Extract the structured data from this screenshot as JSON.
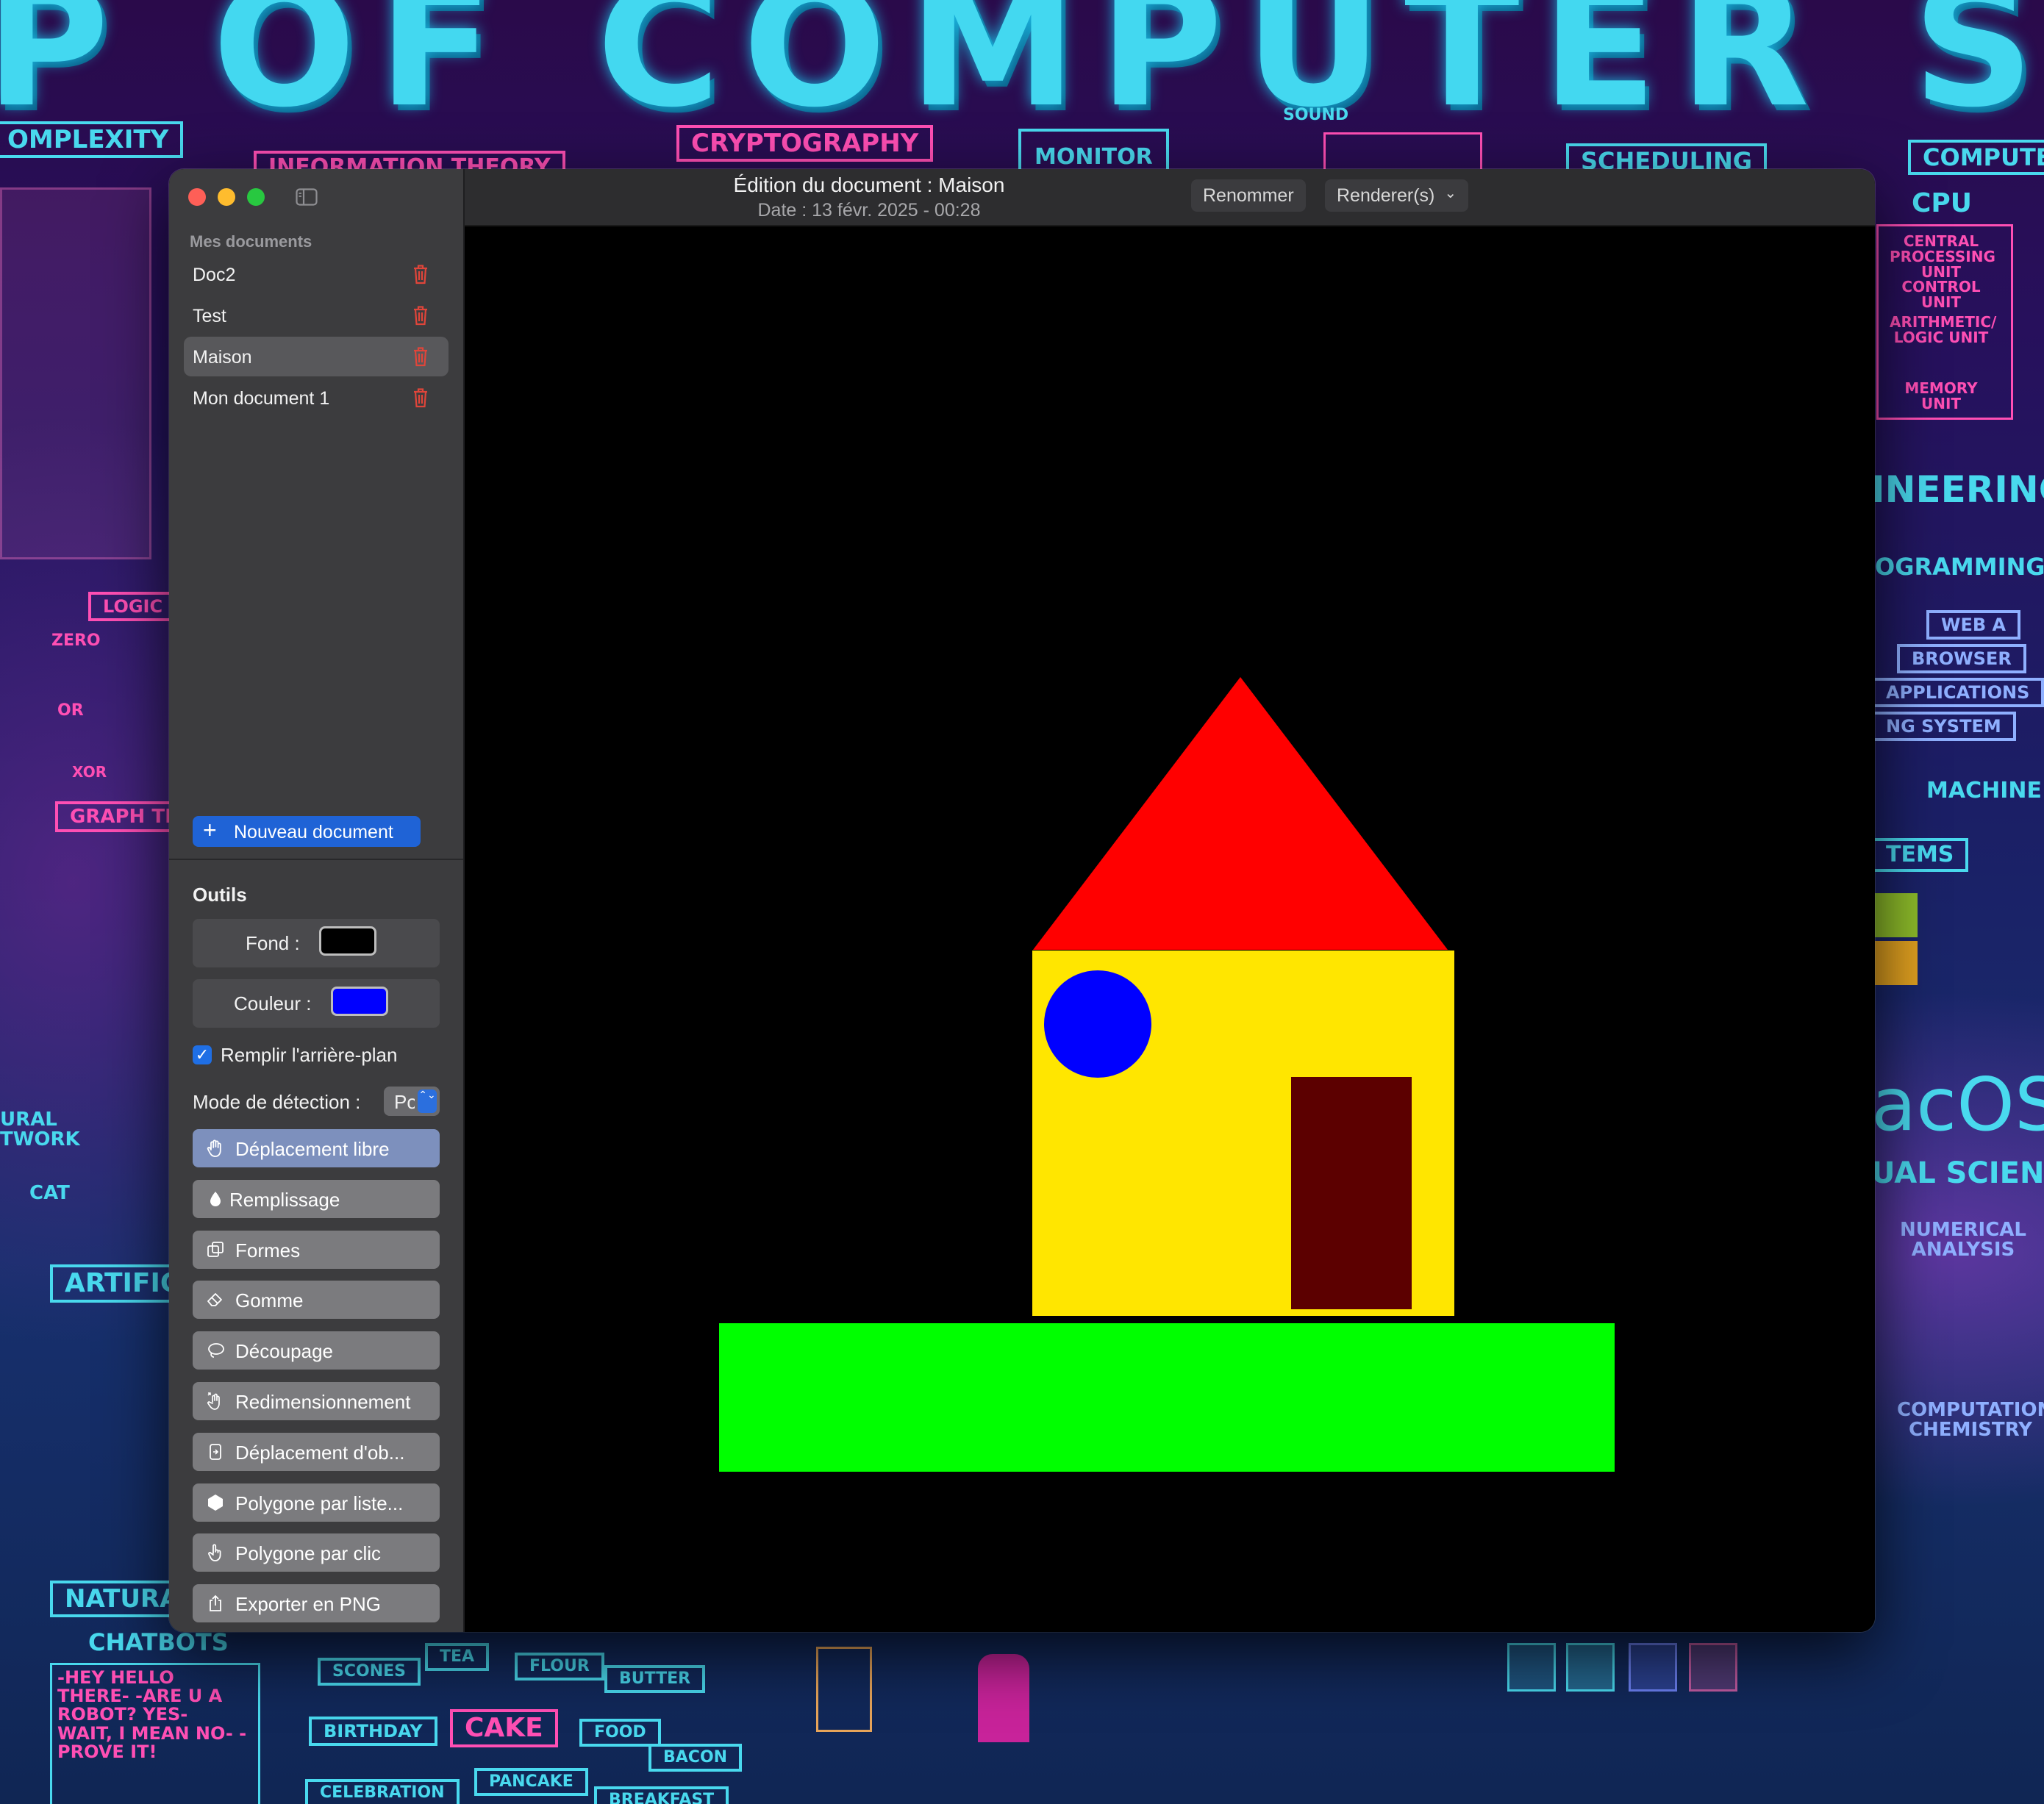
{
  "wallpaper": {
    "title": "P OF COMPUTER SCIE",
    "labels": {
      "complexity": "OMPLEXITY",
      "information_theory": "INFORMATION THEORY",
      "cryptography": "CRYPTOGRAPHY",
      "monitor": "MONITOR",
      "sound": "SOUND",
      "scheduling": "SCHEDULING",
      "compute": "COMPUTE",
      "cpu": "CPU",
      "central_processing_unit": "CENTRAL PROCESSING UNIT",
      "control_unit": "CONTROL UNIT",
      "alu": "ARITHMETIC/ LOGIC UNIT",
      "memory_unit": "MEMORY UNIT",
      "engineering": "INEERING",
      "programming": "OGRAMMING L",
      "web": "WEB A",
      "browser": "BROWSER",
      "applications": "APPLICATIONS",
      "os_system": "NG SYSTEM",
      "machine": "MACHINE C",
      "tems": "TEMS",
      "macos": "acOS",
      "ual_science": "UAL SCIENCE",
      "numerical_analysis": "NUMERICAL ANALYSIS",
      "computational_chemistry": "COMPUTATIONAL CHEMISTRY",
      "logic": "LOGIC",
      "zero": "ZERO",
      "or": "OR",
      "xor": "XOR",
      "graph_theory": "GRAPH THE",
      "artificial": "ARTIFIC",
      "natural": "NATURA",
      "cat": "CAT",
      "neural_network": "URAL TWORK",
      "chatbots": "CHATBOTS",
      "chat_lines": "-HEY HELLO THERE- -ARE U A ROBOT? YES- WAIT, I MEAN NO- -PROVE IT!",
      "scones": "SCONES",
      "tea": "TEA",
      "flour": "FLOUR",
      "butter": "BUTTER",
      "birthday": "BIRTHDAY",
      "cake": "CAKE",
      "food": "FOOD",
      "bacon": "BACON",
      "pancake": "PANCAKE",
      "celebration": "CELEBRATION",
      "breakfast": "BREAKFAST"
    }
  },
  "window": {
    "title": "Édition du document : Maison",
    "subtitle": "Date : 13 févr. 2025 - 00:28",
    "rename_label": "Renommer",
    "renderer_label": "Renderer(s)",
    "renderer_chevron": "⌄"
  },
  "sidebar": {
    "section_title": "Mes documents",
    "documents": [
      {
        "name": "Doc2",
        "selected": false
      },
      {
        "name": "Test",
        "selected": false
      },
      {
        "name": "Maison",
        "selected": true
      },
      {
        "name": "Mon document 1",
        "selected": false
      }
    ],
    "new_document_label": "Nouveau document",
    "new_document_icon": "+",
    "tools_title": "Outils",
    "background_label": "Fond :",
    "background_color": "#000000",
    "color_label": "Couleur :",
    "color_value": "#0000ff",
    "fill_background_label": "Remplir l'arrière-plan",
    "fill_background_checked": true,
    "check_glyph": "✓",
    "detection_mode_label": "Mode de détection :",
    "detection_mode_value": "Po",
    "detection_arrows": "⌃⌄",
    "tools": [
      {
        "label": "Déplacement libre",
        "icon": "hand-icon",
        "active": true
      },
      {
        "label": "Remplissage",
        "icon": "drop-icon",
        "active": false
      },
      {
        "label": "Formes",
        "icon": "shapes-icon",
        "active": false
      },
      {
        "label": "Gomme",
        "icon": "eraser-icon",
        "active": false
      },
      {
        "label": "Découpage",
        "icon": "lasso-icon",
        "active": false
      },
      {
        "label": "Redimensionnement",
        "icon": "resize-hand-icon",
        "active": false
      },
      {
        "label": "Déplacement d'ob...",
        "icon": "move-object-icon",
        "active": false
      },
      {
        "label": "Polygone par liste...",
        "icon": "hexagon-icon",
        "active": false
      },
      {
        "label": "Polygone par clic",
        "icon": "pointer-hand-icon",
        "active": false
      },
      {
        "label": "Exporter en PNG",
        "icon": "share-icon",
        "active": false
      }
    ]
  },
  "drawing": {
    "roof_color": "#ff0000",
    "wall_color": "#ffe600",
    "window_color": "#0000ff",
    "door_color": "#5c0000",
    "ground_color": "#00ff00",
    "background_color": "#000000"
  },
  "colors": {
    "accent": "#1f63d6",
    "trash": "#e0453a"
  }
}
